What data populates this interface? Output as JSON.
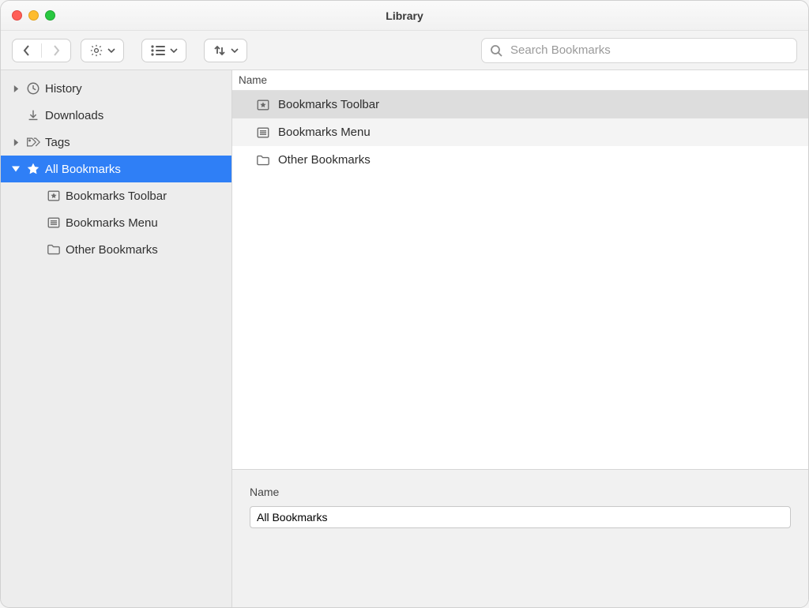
{
  "window": {
    "title": "Library"
  },
  "toolbar": {
    "search_placeholder": "Search Bookmarks"
  },
  "sidebar": {
    "items": [
      {
        "label": "History",
        "expandable": true,
        "expanded": false,
        "icon": "history-icon",
        "selected": false
      },
      {
        "label": "Downloads",
        "expandable": false,
        "icon": "download-icon",
        "selected": false
      },
      {
        "label": "Tags",
        "expandable": true,
        "expanded": false,
        "icon": "tag-icon",
        "selected": false
      },
      {
        "label": "All Bookmarks",
        "expandable": true,
        "expanded": true,
        "icon": "star-icon",
        "selected": true
      }
    ],
    "children": [
      {
        "label": "Bookmarks Toolbar",
        "icon": "toolbar-folder-icon"
      },
      {
        "label": "Bookmarks Menu",
        "icon": "menu-folder-icon"
      },
      {
        "label": "Other Bookmarks",
        "icon": "folder-icon"
      }
    ]
  },
  "main": {
    "column_header": "Name",
    "rows": [
      {
        "label": "Bookmarks Toolbar",
        "icon": "toolbar-folder-icon",
        "selected": true
      },
      {
        "label": "Bookmarks Menu",
        "icon": "menu-folder-icon",
        "selected": false
      },
      {
        "label": "Other Bookmarks",
        "icon": "folder-icon",
        "selected": false
      }
    ]
  },
  "details": {
    "name_label": "Name",
    "name_value": "All Bookmarks"
  }
}
